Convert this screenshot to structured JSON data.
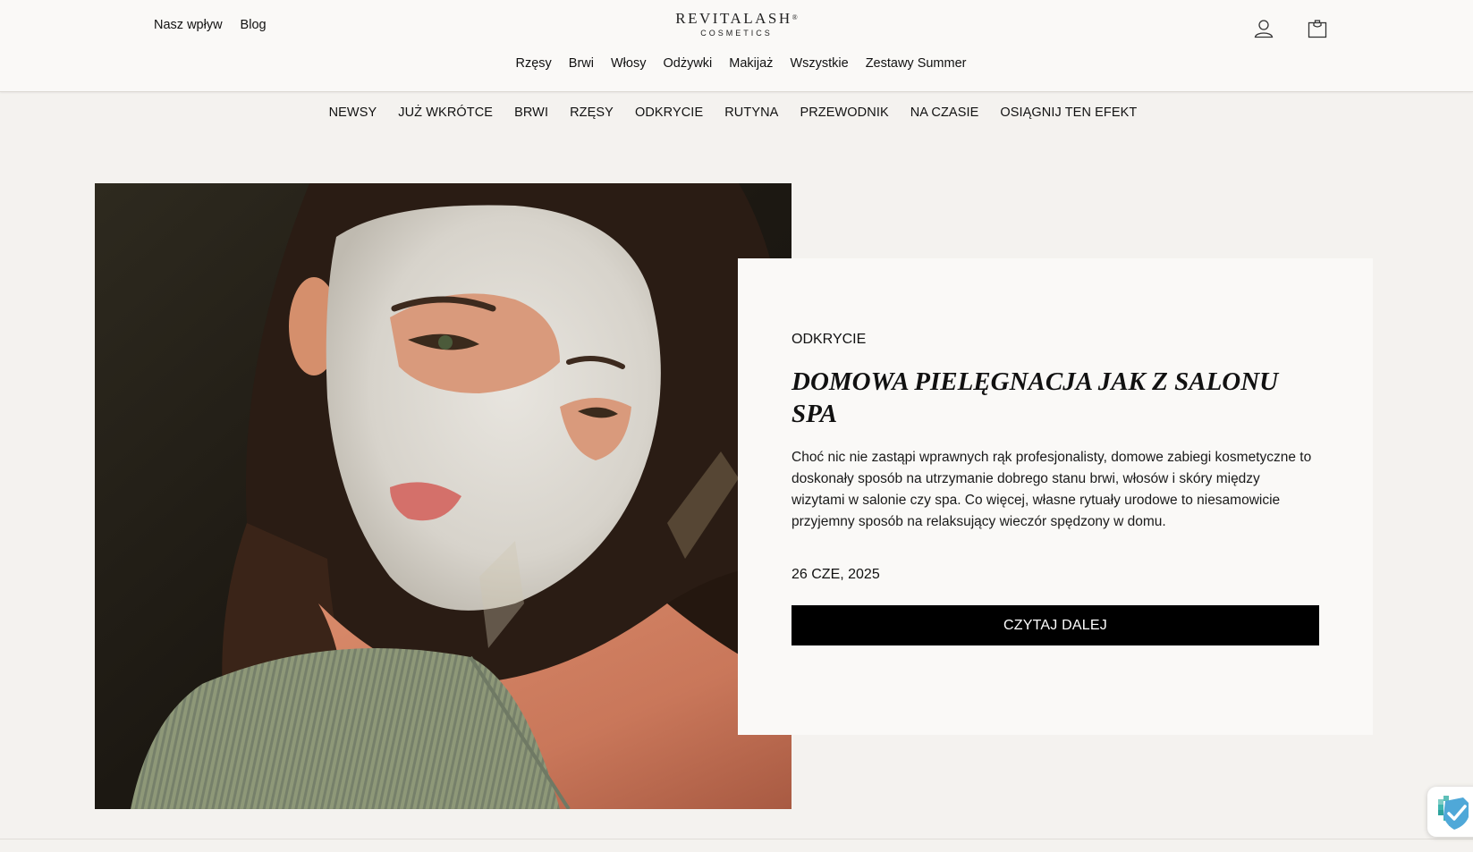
{
  "header": {
    "left_links": [
      "Nasz wpływ",
      "Blog"
    ],
    "logo": {
      "main": "REVITALASH",
      "mark": "®",
      "sub": "COSMETICS"
    },
    "icons": [
      "account-icon",
      "shopping-bag-icon"
    ]
  },
  "main_nav": [
    "Rzęsy",
    "Brwi",
    "Włosy",
    "Odżywki",
    "Makijaż",
    "Wszystkie",
    "Zestawy Summer"
  ],
  "category_nav": [
    "NEWSY",
    "JUŻ WKRÓTCE",
    "BRWI",
    "RZĘSY",
    "ODKRYCIE",
    "RUTYNA",
    "PRZEWODNIK",
    "NA CZASIE",
    "OSIĄGNIJ TEN EFEKT"
  ],
  "article": {
    "category": "ODKRYCIE",
    "title": "DOMOWA PIELĘGNACJA JAK Z SALONU SPA",
    "excerpt": "Choć nic nie zastąpi wprawnych rąk profesjonalisty, domowe zabiegi kosmetyczne to doskonały sposób na utrzymanie dobrego stanu brwi, włosów i skóry między wizytami w salonie czy spa. Co więcej, własne rytuały urodowe to niesamowicie przyjemny sposób na relaksujący wieczór spędzony w domu.",
    "date": "26 CZE, 2025",
    "button_label": "CZYTAJ DALEJ",
    "image": "woman-with-face-mask-photo"
  },
  "badge": {
    "icon": "verified-shield-icon"
  },
  "colors": {
    "page_bg": "#f4f2ef",
    "header_bg": "#faf9f7",
    "card_bg": "#faf9f7",
    "button_bg": "#000000",
    "button_text": "#ffffff",
    "badge_accent": "#3fb6b0"
  }
}
